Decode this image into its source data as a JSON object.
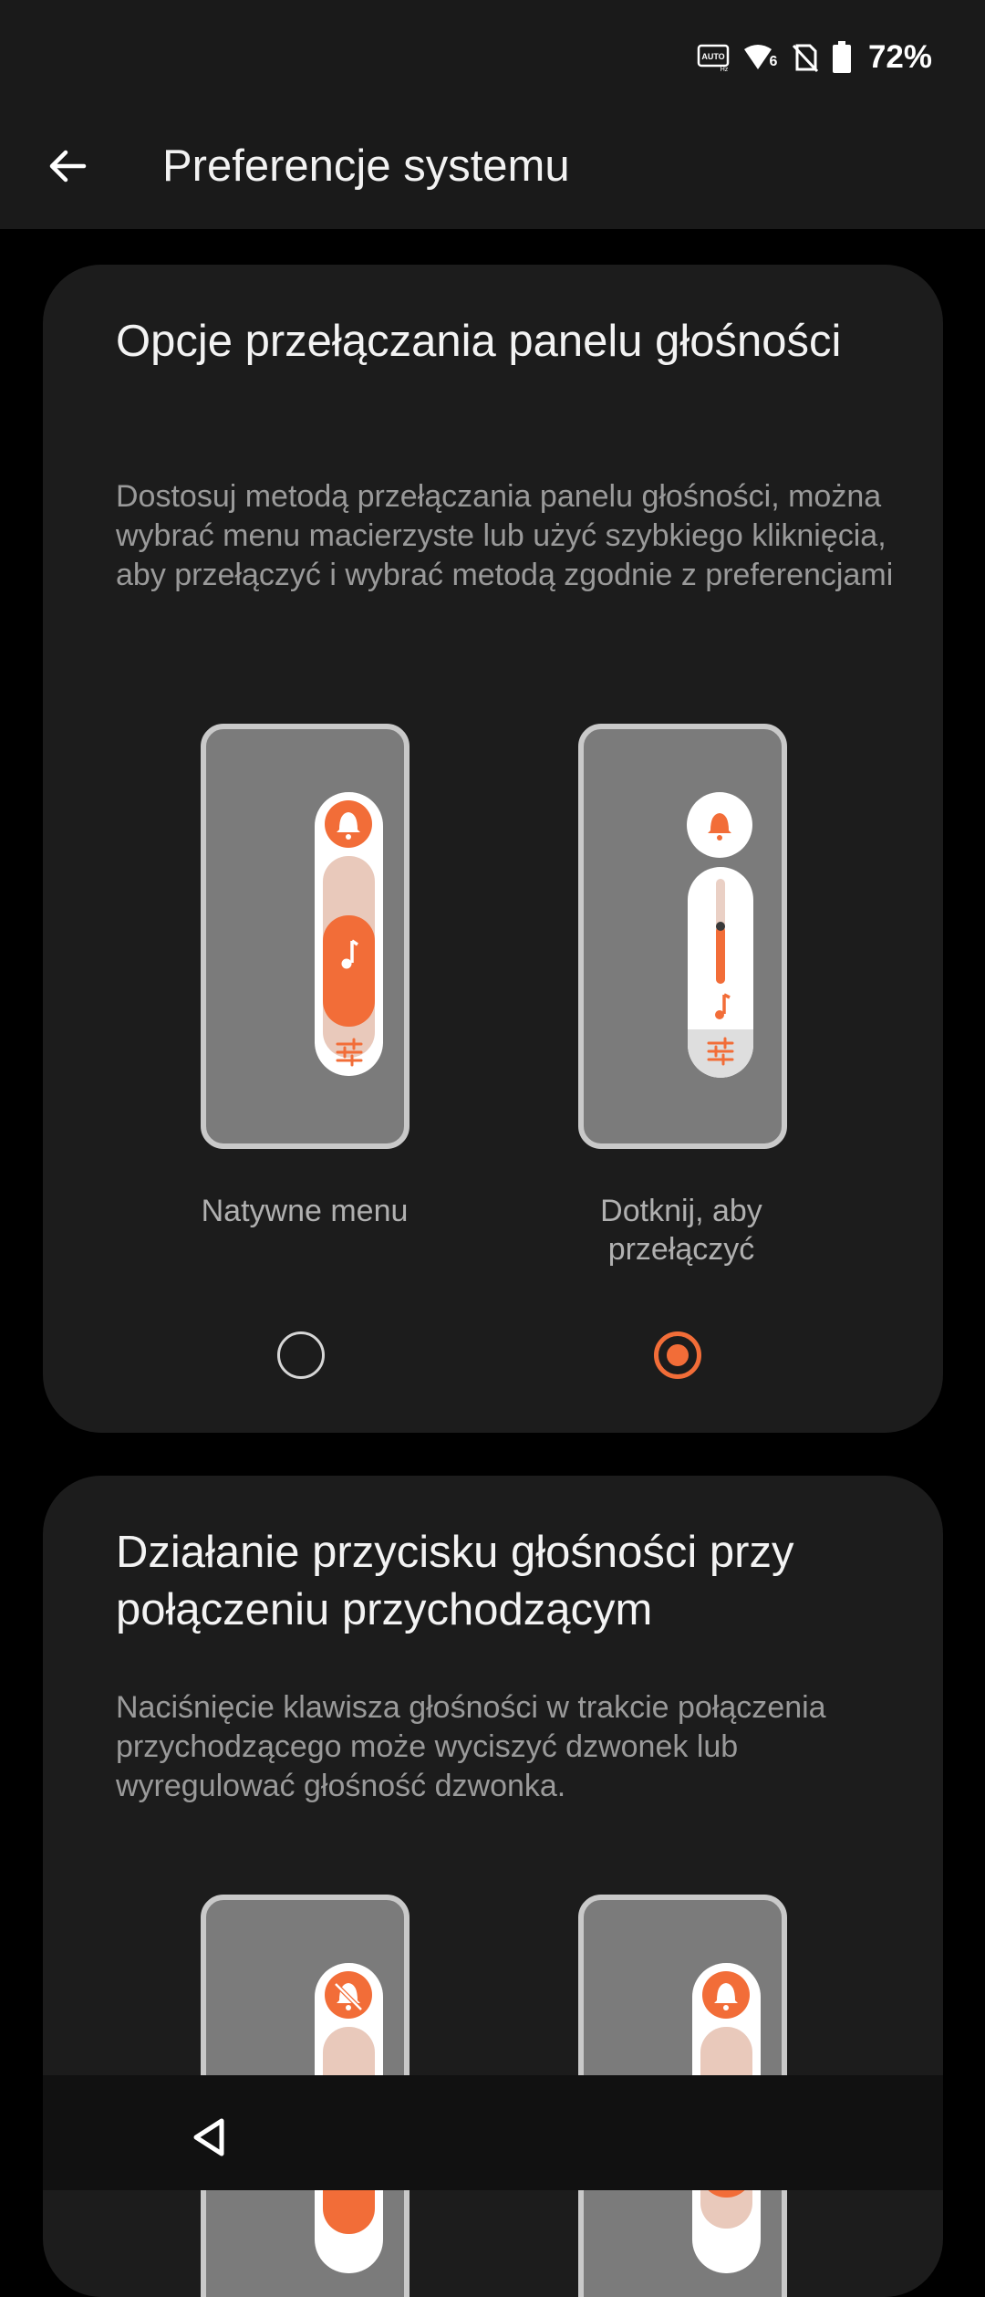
{
  "status": {
    "battery_percent": "72%"
  },
  "header": {
    "title": "Preferencje systemu"
  },
  "card1": {
    "title": "Opcje przełączania panelu głośności",
    "description": "Dostosuj metodą przełączania panelu głośności, można wybrać menu macierzyste lub użyć szybkiego kliknięcia, aby przełączyć i wybrać metodą zgodnie z preferencjami",
    "options": [
      {
        "label": "Natywne menu",
        "selected": false
      },
      {
        "label": "Dotknij, aby przełączyć",
        "selected": true
      }
    ]
  },
  "card2": {
    "title": "Działanie przycisku głośności przy połączeniu przychodzącym",
    "description": "Naciśnięcie klawisza głośności w trakcie połączenia przychodzącego może wyciszyć dzwonek lub wyregulować głośność dzwonka."
  },
  "colors": {
    "accent": "#f26d38",
    "card": "#1c1c1c",
    "background": "#000000"
  },
  "icons": [
    "back-arrow-icon",
    "auto-hz-icon",
    "wifi-6-icon",
    "no-sim-icon",
    "battery-icon",
    "bell-icon",
    "music-note-icon",
    "sliders-icon",
    "bell-off-icon",
    "nav-back-icon"
  ]
}
